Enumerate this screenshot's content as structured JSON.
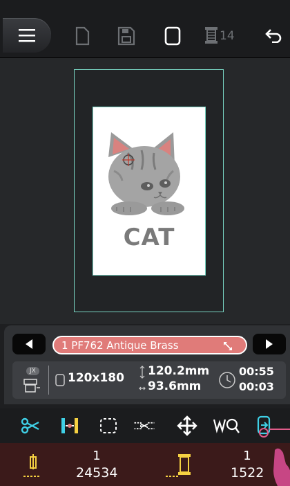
{
  "toolbar": {
    "menu_icon": "hamburger-menu-icon",
    "new_icon": "new-file-icon",
    "save_icon": "save-icon",
    "frame_icon": "hoop-frame-icon",
    "spool_icon": "thread-spool-icon",
    "spool_count": "14",
    "back_icon": "undo-arrow-icon"
  },
  "design": {
    "label": "CAT"
  },
  "thread": {
    "text": "1 PF762  Antique Brass",
    "color": "#e07b79"
  },
  "info": {
    "badge": "JX",
    "size": "120x180",
    "height": "120.2mm",
    "width": "93.6mm",
    "time_total": "00:55",
    "time_current": "00:03"
  },
  "tools": [
    {
      "name": "scissors-icon"
    },
    {
      "name": "align-icon"
    },
    {
      "name": "select-area-icon"
    },
    {
      "name": "basting-icon"
    },
    {
      "name": "move-icon"
    },
    {
      "name": "thread-view-icon"
    },
    {
      "name": "stitch-forward-icon"
    }
  ],
  "counters": {
    "needle_top": "1",
    "needle_bottom": "24534",
    "spool_top": "1",
    "spool_bottom": "1522"
  },
  "colors": {
    "accent": "#79d6c4",
    "highlight": "#e07b79",
    "bottom_bar": "#3b1a1a"
  }
}
